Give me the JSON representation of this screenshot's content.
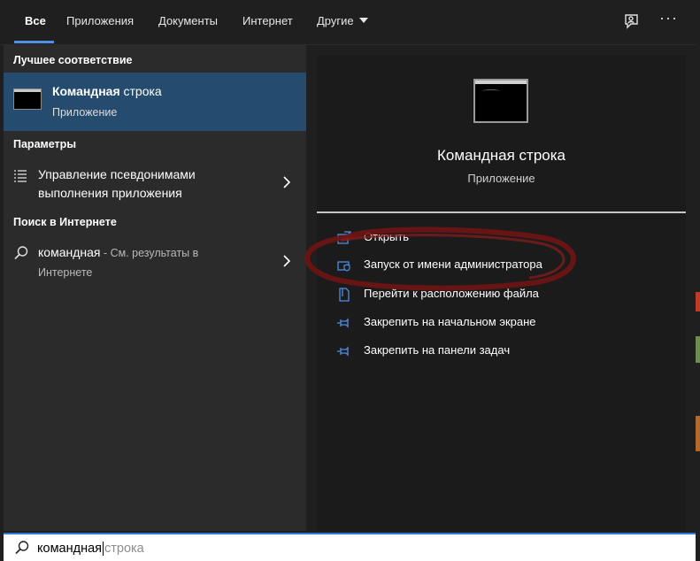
{
  "tabs": [
    {
      "label": "Все",
      "active": true
    },
    {
      "label": "Приложения"
    },
    {
      "label": "Документы"
    },
    {
      "label": "Интернет"
    },
    {
      "label": "Другие"
    }
  ],
  "topbar_icons": [
    "feedback-icon",
    "more-icon"
  ],
  "more_label": "···",
  "best_match": {
    "section": "Лучшее соответствие",
    "name_bold": "Командная",
    "name_rest": " строка",
    "type": "Приложение"
  },
  "settings": {
    "section": "Параметры",
    "item_line1": "Управление псевдонимами",
    "item_line2": "выполнения приложения"
  },
  "web": {
    "section": "Поиск в Интернете",
    "query": "командная",
    "suffix": " - См. результаты в",
    "suffix2": "Интернете"
  },
  "preview": {
    "title": "Командная строка",
    "subtitle": "Приложение",
    "actions": [
      {
        "label": "Открыть",
        "icon": "open-icon"
      },
      {
        "label": "Запуск от имени администратора",
        "icon": "shield-icon"
      },
      {
        "label": "Перейти к расположению файла",
        "icon": "file-location-icon"
      },
      {
        "label": "Закрепить на начальном экране",
        "icon": "pin-icon"
      },
      {
        "label": "Закрепить на панели задач",
        "icon": "pin-icon"
      }
    ]
  },
  "search": {
    "typed": "командная",
    "completion": "строка"
  },
  "colors": {
    "accent": "#4f8fe6",
    "selected_bg": "#254c6e",
    "annotation": "#7a1a1a"
  }
}
